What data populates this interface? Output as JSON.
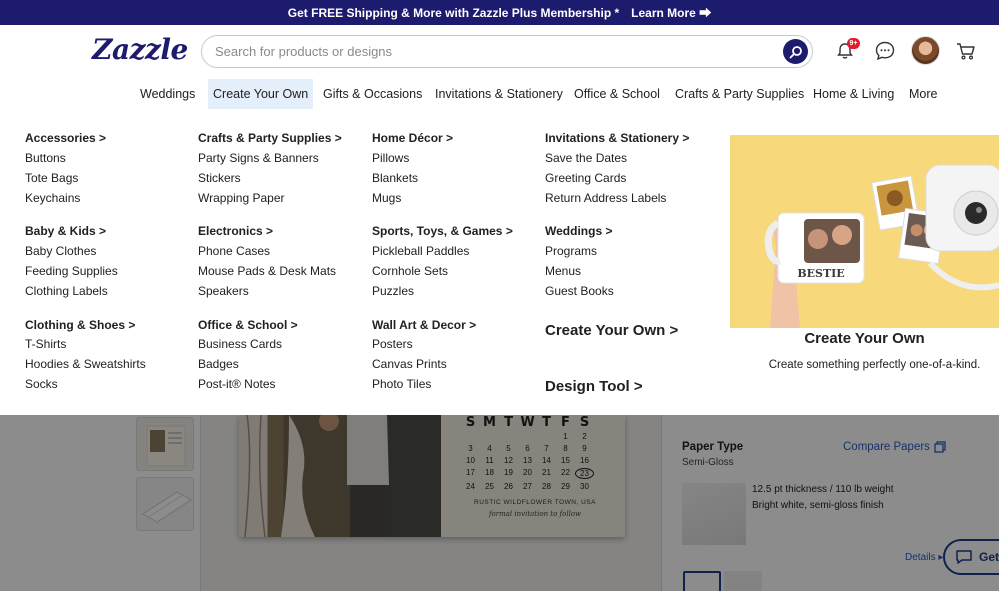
{
  "promo": {
    "text": "Get FREE Shipping & More with Zazzle Plus Membership *",
    "link": "Learn More ⮕"
  },
  "header": {
    "logo": "Zazzle",
    "search_placeholder": "Search for products or designs",
    "notification_count": "9+"
  },
  "nav": {
    "items": [
      "Weddings",
      "Create Your Own",
      "Gifts & Occasions",
      "Invitations & Stationery",
      "Office & School",
      "Crafts & Party Supplies",
      "Home & Living",
      "More"
    ],
    "active": "Create Your Own"
  },
  "menu": {
    "col1": {
      "g1": {
        "head": "Accessories >",
        "items": [
          "Buttons",
          "Tote Bags",
          "Keychains"
        ]
      },
      "g2": {
        "head": "Baby & Kids >",
        "items": [
          "Baby Clothes",
          "Feeding Supplies",
          "Clothing Labels"
        ]
      },
      "g3": {
        "head": "Clothing & Shoes >",
        "items": [
          "T-Shirts",
          "Hoodies & Sweatshirts",
          "Socks"
        ]
      }
    },
    "col2": {
      "g1": {
        "head": "Crafts & Party Supplies >",
        "items": [
          "Party Signs & Banners",
          "Stickers",
          "Wrapping Paper"
        ]
      },
      "g2": {
        "head": "Electronics >",
        "items": [
          "Phone Cases",
          "Mouse Pads & Desk Mats",
          "Speakers"
        ]
      },
      "g3": {
        "head": "Office & School >",
        "items": [
          "Business Cards",
          "Badges",
          "Post-it® Notes"
        ]
      }
    },
    "col3": {
      "g1": {
        "head": "Home Décor >",
        "items": [
          "Pillows",
          "Blankets",
          "Mugs"
        ]
      },
      "g2": {
        "head": "Sports, Toys, & Games >",
        "items": [
          "Pickleball Paddles",
          "Cornhole Sets",
          "Puzzles"
        ]
      },
      "g3": {
        "head": "Wall Art & Decor >",
        "items": [
          "Posters",
          "Canvas Prints",
          "Photo Tiles"
        ]
      }
    },
    "col4": {
      "g1": {
        "head": "Invitations & Stationery >",
        "items": [
          "Save the Dates",
          "Greeting Cards",
          "Return Address Labels"
        ]
      },
      "g2": {
        "head": "Weddings >",
        "items": [
          "Programs",
          "Menus",
          "Guest Books"
        ]
      },
      "create_link": "Create Your Own >",
      "design_link": "Design Tool >"
    },
    "feature": {
      "mug_text": "BESTIE",
      "title": "Create Your Own",
      "subtitle": "Create something perfectly one-of-a-kind."
    }
  },
  "background_page": {
    "calendar": {
      "days": [
        "S",
        "M",
        "T",
        "W",
        "T",
        "F",
        "S"
      ],
      "rows": [
        [
          "",
          "",
          "",
          "",
          "",
          "1",
          "2"
        ],
        [
          "3",
          "4",
          "5",
          "6",
          "7",
          "8",
          "9"
        ],
        [
          "10",
          "11",
          "12",
          "13",
          "14",
          "15",
          "16"
        ],
        [
          "17",
          "18",
          "19",
          "20",
          "21",
          "22",
          "23"
        ],
        [
          "24",
          "25",
          "26",
          "27",
          "28",
          "29",
          "30"
        ]
      ],
      "circled": "23",
      "location": "RUSTIC WILDFLOWER TOWN, USA",
      "note": "formal invitation to follow"
    },
    "paper_type_label": "Paper Type",
    "paper_type_value": "Semi-Gloss",
    "compare_link": "Compare Papers",
    "spec_line1": "12.5 pt thickness / 110 lb weight",
    "spec_line2": "Bright white, semi-gloss finish",
    "details_link": "Details",
    "help_label": "Get"
  }
}
